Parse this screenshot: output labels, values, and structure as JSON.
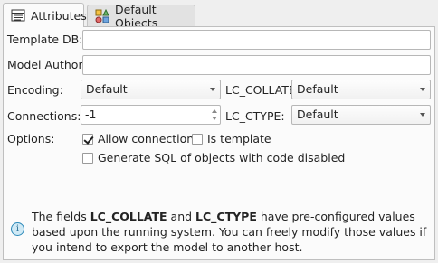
{
  "tabs": [
    {
      "label": "Attributes",
      "active": true,
      "icon": "table-icon"
    },
    {
      "label": "Default Objects",
      "active": false,
      "icon": "objects-icon"
    }
  ],
  "form": {
    "template_db_label": "Template DB:",
    "template_db_value": "",
    "model_author_label": "Model Author:",
    "model_author_value": "",
    "encoding_label": "Encoding:",
    "encoding_value": "Default",
    "lc_collate_label": "LC_COLLATE:",
    "lc_collate_value": "Default",
    "connections_label": "Connections:",
    "connections_value": "-1",
    "lc_ctype_label": "LC_CTYPE:",
    "lc_ctype_value": "Default",
    "options_label": "Options:",
    "allow_connections_label": "Allow connections",
    "allow_connections_checked": true,
    "is_template_label": "Is template",
    "is_template_checked": false,
    "gen_sql_label": "Generate SQL of objects with code disabled",
    "gen_sql_checked": false
  },
  "info": {
    "pre": "The fields ",
    "f1": "LC_COLLATE",
    "mid": " and ",
    "f2": "LC_CTYPE",
    "post": " have pre-configured values based upon the running system. You can freely modify those values if you intend to export the model to another host."
  },
  "colors": {
    "panel": "#fbfbfb",
    "background": "#efefef",
    "info_icon": "#2a88b8"
  }
}
